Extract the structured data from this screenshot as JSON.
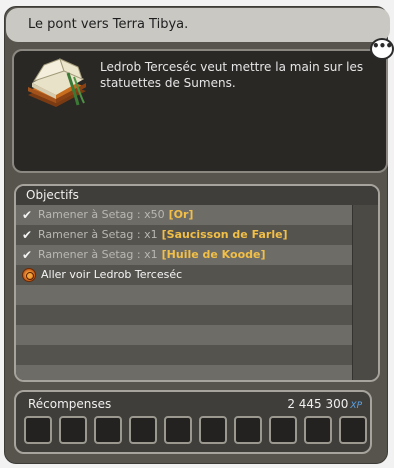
{
  "quest": {
    "title": "Le pont vers Terra Tibya.",
    "description": "Ledrob Terceséc veut mettre la main sur les statuettes de Sumens."
  },
  "objectives": {
    "header": "Objectifs",
    "rows": [
      {
        "status": "done",
        "text": "Ramener à Setag : x50",
        "item": "[Or]"
      },
      {
        "status": "done",
        "text": "Ramener à Setag : x1",
        "item": "[Saucisson de Farle]"
      },
      {
        "status": "done",
        "text": "Ramener à Setag : x1",
        "item": "[Huile de Koode]"
      },
      {
        "status": "active",
        "text": "Aller voir Ledrob Terceséc",
        "item": ""
      }
    ]
  },
  "rewards": {
    "label": "Récompenses",
    "xp_value": "2 445 300",
    "xp_unit": "XP"
  },
  "icons": {
    "quest_icon": "open-book-icon",
    "chat": "speech-bubble-icon",
    "done": "check-icon",
    "active": "action-target-icon"
  },
  "colors": {
    "item_highlight": "#f2bf47",
    "xp_unit": "#5ba3e8"
  }
}
